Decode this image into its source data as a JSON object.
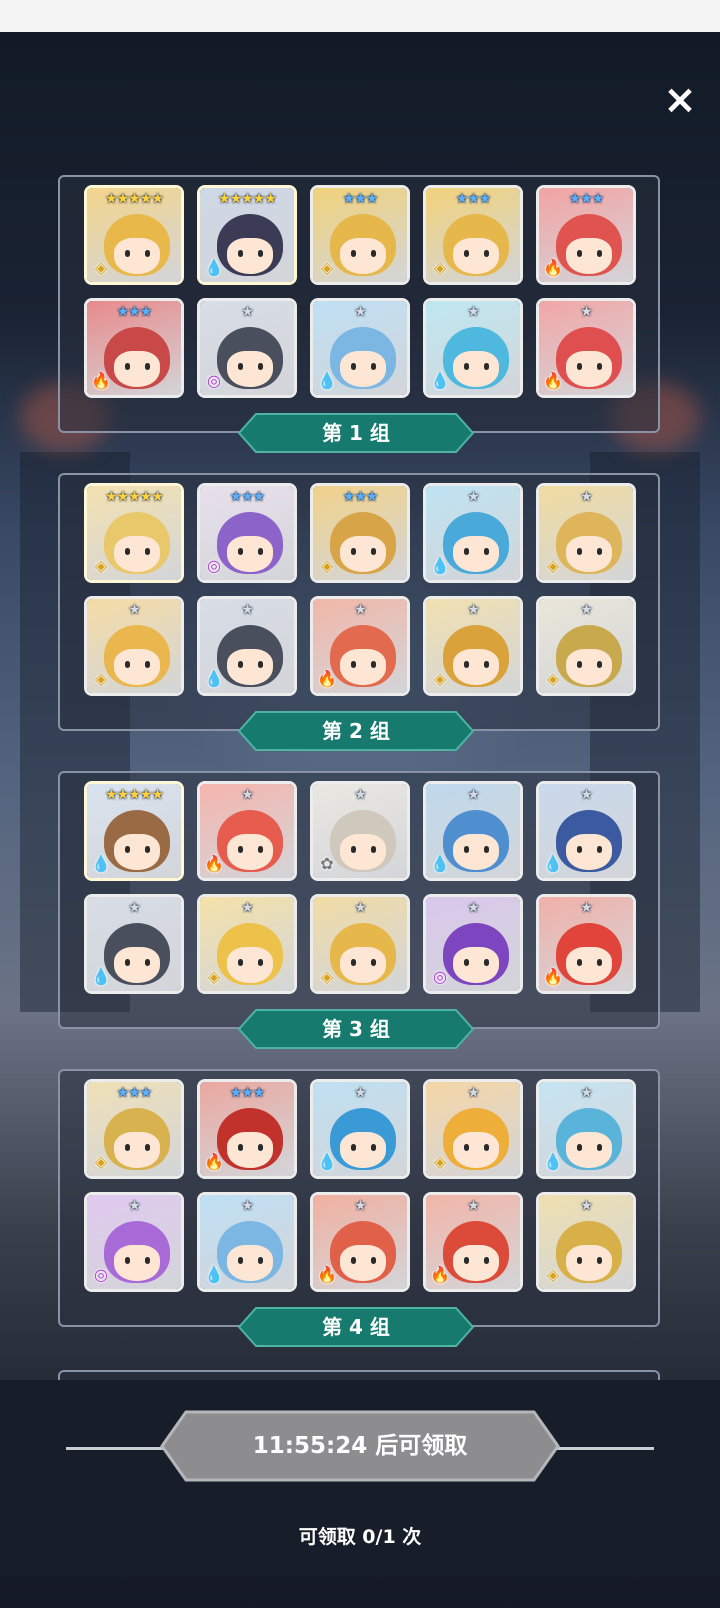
{
  "colors": {
    "panel_border": "#8a93a6",
    "label_fill": "#167a6e",
    "claim_button_fill": "#8d8d8f",
    "star_gold": "#ffd23a",
    "star_blue": "#5ab0ff",
    "star_silver": "#d7dbe2",
    "water": "#1f6fd6",
    "fire": "#e0442f",
    "light": "#d8a21e",
    "dark": "#b23ad6",
    "nature": "#7a7a7a"
  },
  "close_icon": "×",
  "groups": [
    {
      "label": "第 1 组",
      "heroes": [
        {
          "stars": "★★★★★",
          "star_color": "gold",
          "element_icon": "◈",
          "element": "light",
          "portrait": "gold-hair"
        },
        {
          "stars": "★★★★★",
          "star_color": "gold",
          "element_icon": "💧",
          "element": "water",
          "portrait": "masked-blue"
        },
        {
          "stars": "★★★",
          "star_color": "blue",
          "element_icon": "◈",
          "element": "light",
          "portrait": "gold-knight"
        },
        {
          "stars": "★★★",
          "star_color": "blue",
          "element_icon": "◈",
          "element": "light",
          "portrait": "gold-knight"
        },
        {
          "stars": "★★★",
          "star_color": "blue",
          "element_icon": "🔥",
          "element": "fire",
          "portrait": "red-queen"
        },
        {
          "stars": "★★★",
          "star_color": "blue",
          "element_icon": "🔥",
          "element": "fire",
          "portrait": "red-golem"
        },
        {
          "stars": "★",
          "star_color": "silver",
          "element_icon": "◎",
          "element": "dark",
          "portrait": "helmet-knight"
        },
        {
          "stars": "★",
          "star_color": "silver",
          "element_icon": "💧",
          "element": "water",
          "portrait": "blue-slime"
        },
        {
          "stars": "★",
          "star_color": "silver",
          "element_icon": "💧",
          "element": "water",
          "portrait": "cyan-girl"
        },
        {
          "stars": "★",
          "star_color": "silver",
          "element_icon": "🔥",
          "element": "fire",
          "portrait": "red-beast"
        }
      ]
    },
    {
      "label": "第 2 组",
      "heroes": [
        {
          "stars": "★★★★★",
          "star_color": "gold",
          "element_icon": "◈",
          "element": "light",
          "portrait": "gold-princess"
        },
        {
          "stars": "★★★",
          "star_color": "blue",
          "element_icon": "◎",
          "element": "dark",
          "portrait": "white-ninja"
        },
        {
          "stars": "★★★",
          "star_color": "blue",
          "element_icon": "◈",
          "element": "light",
          "portrait": "gold-golem"
        },
        {
          "stars": "★",
          "star_color": "silver",
          "element_icon": "💧",
          "element": "water",
          "portrait": "blue-bow"
        },
        {
          "stars": "★",
          "star_color": "silver",
          "element_icon": "◈",
          "element": "light",
          "portrait": "cactus"
        },
        {
          "stars": "★",
          "star_color": "silver",
          "element_icon": "◈",
          "element": "light",
          "portrait": "fox-girl"
        },
        {
          "stars": "★",
          "star_color": "silver",
          "element_icon": "💧",
          "element": "water",
          "portrait": "helmet-knight"
        },
        {
          "stars": "★",
          "star_color": "silver",
          "element_icon": "🔥",
          "element": "fire",
          "portrait": "red-paladin"
        },
        {
          "stars": "★",
          "star_color": "silver",
          "element_icon": "◈",
          "element": "light",
          "portrait": "gold-sun"
        },
        {
          "stars": "★",
          "star_color": "silver",
          "element_icon": "◈",
          "element": "light",
          "portrait": "white-knight"
        }
      ]
    },
    {
      "label": "第 3 组",
      "heroes": [
        {
          "stars": "★★★★★",
          "star_color": "gold",
          "element_icon": "💧",
          "element": "water",
          "portrait": "deer-mask"
        },
        {
          "stars": "★",
          "star_color": "silver",
          "element_icon": "🔥",
          "element": "fire",
          "portrait": "red-bow"
        },
        {
          "stars": "★",
          "star_color": "silver",
          "element_icon": "✿",
          "element": "nature",
          "portrait": "white-girl"
        },
        {
          "stars": "★",
          "star_color": "silver",
          "element_icon": "💧",
          "element": "water",
          "portrait": "blue-skull"
        },
        {
          "stars": "★",
          "star_color": "silver",
          "element_icon": "💧",
          "element": "water",
          "portrait": "blue-witch"
        },
        {
          "stars": "★",
          "star_color": "silver",
          "element_icon": "💧",
          "element": "water",
          "portrait": "helmet-knight"
        },
        {
          "stars": "★",
          "star_color": "silver",
          "element_icon": "◈",
          "element": "light",
          "portrait": "gold-antenna"
        },
        {
          "stars": "★",
          "star_color": "silver",
          "element_icon": "◈",
          "element": "light",
          "portrait": "gold-paladin"
        },
        {
          "stars": "★",
          "star_color": "silver",
          "element_icon": "◎",
          "element": "dark",
          "portrait": "purple-card"
        },
        {
          "stars": "★",
          "star_color": "silver",
          "element_icon": "🔥",
          "element": "fire",
          "portrait": "red-knight"
        }
      ]
    },
    {
      "label": "第 4 组",
      "heroes": [
        {
          "stars": "★★★",
          "star_color": "blue",
          "element_icon": "◈",
          "element": "light",
          "portrait": "gold-witch"
        },
        {
          "stars": "★★★",
          "star_color": "blue",
          "element_icon": "🔥",
          "element": "fire",
          "portrait": "red-book"
        },
        {
          "stars": "★",
          "star_color": "silver",
          "element_icon": "💧",
          "element": "water",
          "portrait": "blue-fluff"
        },
        {
          "stars": "★",
          "star_color": "silver",
          "element_icon": "◈",
          "element": "light",
          "portrait": "orange-girl"
        },
        {
          "stars": "★",
          "star_color": "silver",
          "element_icon": "💧",
          "element": "water",
          "portrait": "blue-dragon"
        },
        {
          "stars": "★",
          "star_color": "silver",
          "element_icon": "◎",
          "element": "dark",
          "portrait": "purple-witch"
        },
        {
          "stars": "★",
          "star_color": "silver",
          "element_icon": "💧",
          "element": "water",
          "portrait": "blue-slime"
        },
        {
          "stars": "★",
          "star_color": "silver",
          "element_icon": "🔥",
          "element": "fire",
          "portrait": "red-castle"
        },
        {
          "stars": "★",
          "star_color": "silver",
          "element_icon": "🔥",
          "element": "fire",
          "portrait": "red-oni"
        },
        {
          "stars": "★",
          "star_color": "silver",
          "element_icon": "◈",
          "element": "light",
          "portrait": "gold-totem"
        }
      ]
    }
  ],
  "claim": {
    "button_label": "11:55:24 后可领取",
    "count_label": "可领取 0/1 次"
  }
}
